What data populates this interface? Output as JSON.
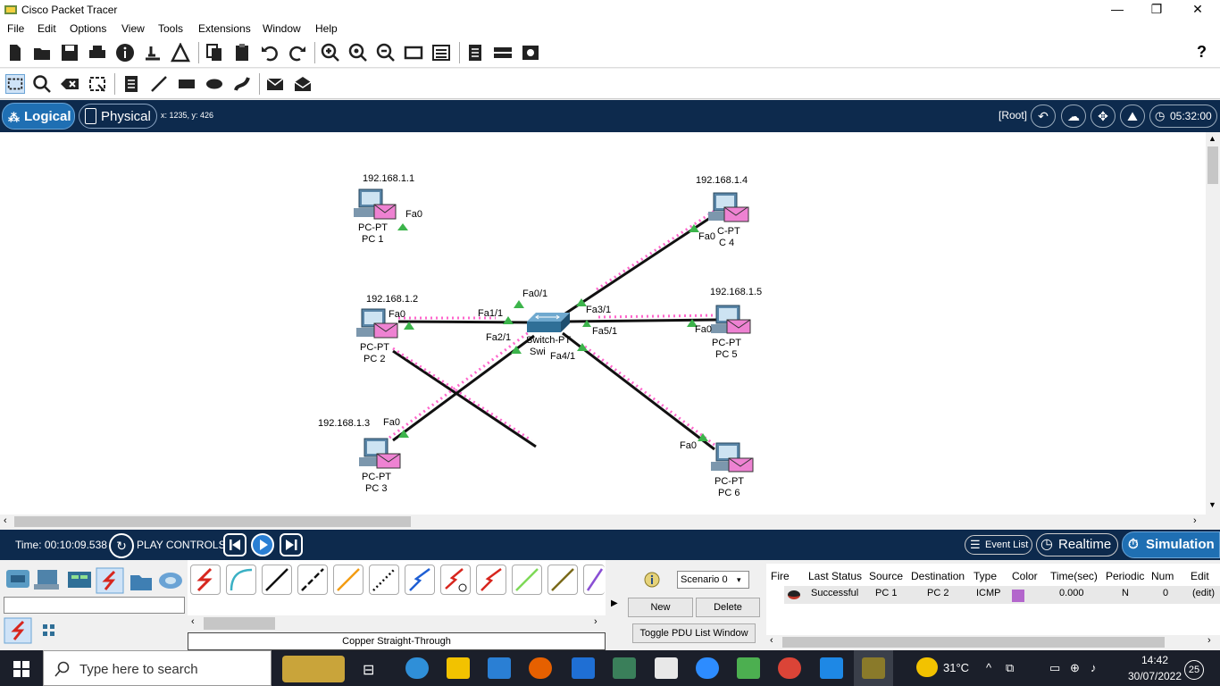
{
  "window": {
    "title": "Cisco Packet Tracer",
    "minimize": "—",
    "maximize": "❐",
    "close": "✕"
  },
  "menu": [
    "File",
    "Edit",
    "Options",
    "View",
    "Tools",
    "Extensions",
    "Window",
    "Help"
  ],
  "toolbar": {
    "help": "?"
  },
  "nav": {
    "logical": "Logical",
    "physical": "Physical",
    "coords": "x: 1235, y: 426",
    "root": "[Root]",
    "clock": "05:32:00"
  },
  "topology": {
    "pcs": [
      {
        "name": "PC 1",
        "model": "PC-PT",
        "ip": "192.168.1.1",
        "port": "Fa0"
      },
      {
        "name": "PC 2",
        "model": "PC-PT",
        "ip": "192.168.1.2",
        "port": "Fa0"
      },
      {
        "name": "PC 3",
        "model": "PC-PT",
        "ip": "192.168.1.3",
        "port": "Fa0"
      },
      {
        "name": "C 4",
        "model": "C-PT",
        "ip": "192.168.1.4",
        "port": "Fa0"
      },
      {
        "name": "PC 5",
        "model": "PC-PT",
        "ip": "192.168.1.5",
        "port": "Fa0"
      },
      {
        "name": "PC 6",
        "model": "PC-PT",
        "ip": "",
        "port": "Fa0"
      }
    ],
    "switch": {
      "model": "Switch-PT",
      "name": "Swi",
      "ports": [
        "Fa0/1",
        "Fa1/1",
        "Fa2/1",
        "Fa3/1",
        "Fa5/1",
        "Fa4/1"
      ]
    }
  },
  "sim": {
    "time": "Time: 00:10:09.538",
    "play_controls": "PLAY CONTROLS:",
    "event_list": "Event List",
    "realtime": "Realtime",
    "simulation": "Simulation"
  },
  "connections": {
    "selected_name": "Copper Straight-Through"
  },
  "scenario": {
    "selected": "Scenario 0",
    "new": "New",
    "delete": "Delete",
    "toggle": "Toggle PDU List Window"
  },
  "pdu_table": {
    "headers": [
      "Fire",
      "Last Status",
      "Source",
      "Destination",
      "Type",
      "Color",
      "Time(sec)",
      "Periodic",
      "Num",
      "Edit"
    ],
    "rows": [
      {
        "last_status": "Successful",
        "source": "PC 1",
        "destination": "PC 2",
        "type": "ICMP",
        "color": "#b366cc",
        "time": "0.000",
        "periodic": "N",
        "num": "0",
        "edit": "(edit)"
      }
    ]
  },
  "taskbar": {
    "search_placeholder": "Type here to search",
    "weather": "31°C",
    "time": "14:42",
    "date": "30/07/2022",
    "notifications": "25"
  },
  "colors": {
    "nav_bg": "#0d2a4d",
    "accent": "#1f6fb3",
    "link_packets": "#ff66cc",
    "port_led": "#3cb44b"
  }
}
